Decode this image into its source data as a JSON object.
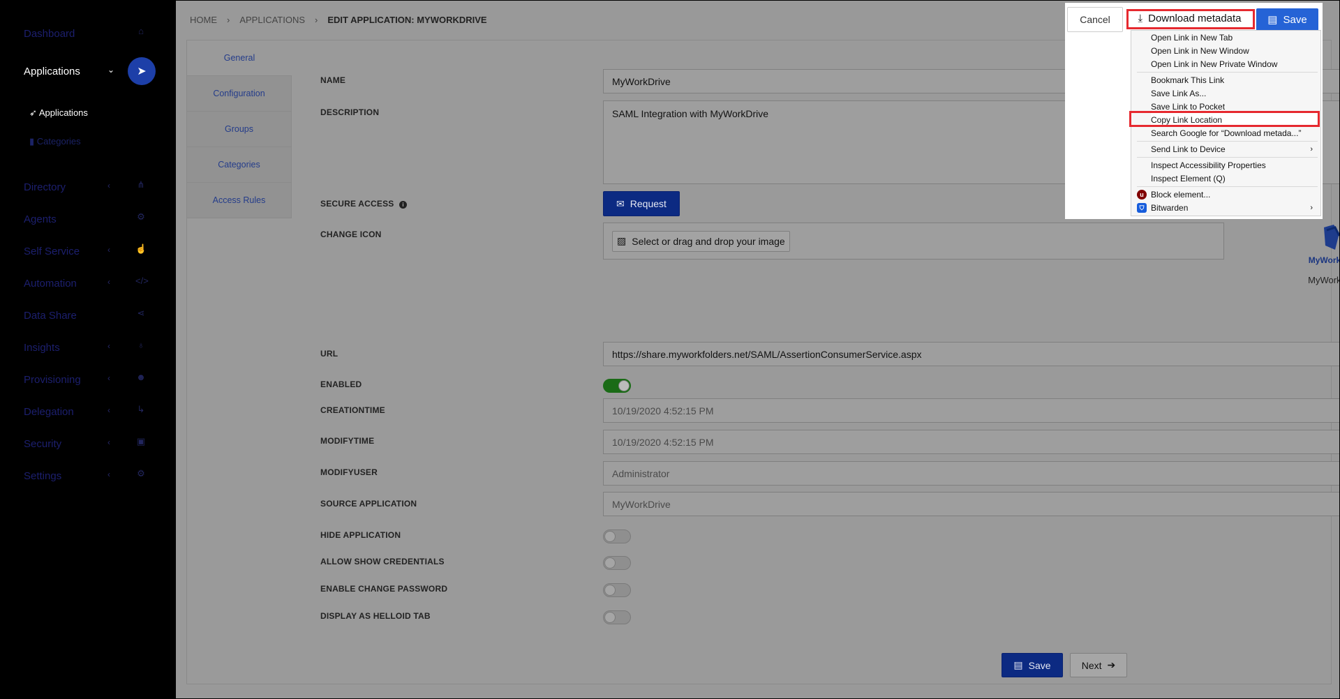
{
  "sidebar": {
    "items": [
      {
        "label": "Dashboard",
        "icon": "home-icon",
        "chevron": false
      },
      {
        "label": "Applications",
        "icon": "rocket-icon",
        "chevron": true
      },
      {
        "label": "Directory",
        "icon": "sitemap-icon",
        "chevron": true
      },
      {
        "label": "Agents",
        "icon": "cogs-icon",
        "chevron": false
      },
      {
        "label": "Self Service",
        "icon": "hand-pointer-icon",
        "chevron": true
      },
      {
        "label": "Automation",
        "icon": "code-icon",
        "chevron": true
      },
      {
        "label": "Data Share",
        "icon": "share-icon",
        "chevron": false
      },
      {
        "label": "Insights",
        "icon": "lightbulb-icon",
        "chevron": true
      },
      {
        "label": "Provisioning",
        "icon": "users-icon",
        "chevron": true
      },
      {
        "label": "Delegation",
        "icon": "level-down-icon",
        "chevron": true
      },
      {
        "label": "Security",
        "icon": "lock-icon",
        "chevron": true
      },
      {
        "label": "Settings",
        "icon": "gear-icon",
        "chevron": true
      }
    ],
    "sub_applications": "Applications",
    "sub_categories": "Categories"
  },
  "breadcrumb": {
    "home": "HOME",
    "applications": "APPLICATIONS",
    "current": "EDIT APPLICATION: MYWORKDRIVE"
  },
  "tabs": [
    "General",
    "Configuration",
    "Groups",
    "Categories",
    "Access Rules"
  ],
  "form": {
    "name_label": "NAME",
    "name_value": "MyWorkDrive",
    "description_label": "DESCRIPTION",
    "description_value": "SAML Integration with MyWorkDrive",
    "secure_access_label": "SECURE ACCESS",
    "request_label": "Request",
    "change_icon_label": "CHANGE ICON",
    "select_image_label": "Select or drag and drop your image",
    "logo_text": "MyWorkDrive",
    "logo_caption": "MyWorkDrive",
    "url_label": "URL",
    "url_value": "https://share.myworkfolders.net/SAML/AssertionConsumerService.aspx",
    "enabled_label": "ENABLED",
    "enabled": true,
    "creationtime_label": "CREATIONTIME",
    "creationtime_value": "10/19/2020 4:52:15 PM",
    "modifytime_label": "MODIFYTIME",
    "modifytime_value": "10/19/2020 4:52:15 PM",
    "modifyuser_label": "MODIFYUSER",
    "modifyuser_value": "Administrator",
    "source_app_label": "SOURCE APPLICATION",
    "source_app_value": "MyWorkDrive",
    "hide_app_label": "HIDE APPLICATION",
    "hide_app": false,
    "allow_creds_label": "ALLOW SHOW CREDENTIALS",
    "allow_creds": false,
    "enable_change_pw_label": "ENABLE CHANGE PASSWORD",
    "enable_change_pw": false,
    "display_helloid_label": "DISPLAY AS HELLOID TAB",
    "display_helloid": false
  },
  "footer": {
    "save_label": "Save",
    "next_label": "Next"
  },
  "toolbar": {
    "cancel_label": "Cancel",
    "download_label": "Download metadata",
    "save_label": "Save"
  },
  "context_menu": {
    "items": [
      "Open Link in New Tab",
      "Open Link in New Window",
      "Open Link in New Private Window",
      "Bookmark This Link",
      "Save Link As...",
      "Save Link to Pocket",
      "Copy Link Location",
      "Search Google for “Download metada...”",
      "Send Link to Device",
      "Inspect Accessibility Properties",
      "Inspect Element (Q)",
      "Block element...",
      "Bitwarden"
    ]
  },
  "colors": {
    "accent": "#0c2a82",
    "highlight": "#e6292f",
    "toggle_on": "#1a6b16",
    "sidebar_bg": "#000000"
  }
}
